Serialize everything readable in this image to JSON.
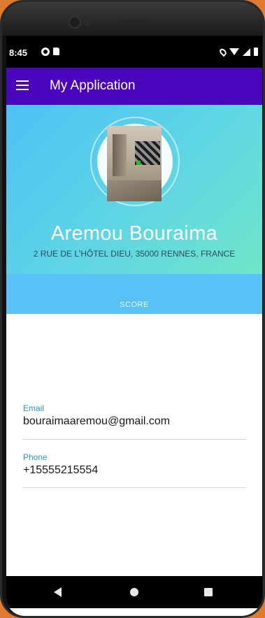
{
  "status_bar": {
    "time": "8:45",
    "left_icons": [
      "google-icon",
      "sd-card-icon"
    ],
    "right_icons": [
      "location-icon",
      "wifi-icon",
      "signal-icon",
      "battery-icon"
    ]
  },
  "app_bar": {
    "title": "My Application",
    "menu_icon": "menu-icon",
    "color": "#4a05bd"
  },
  "profile": {
    "name": "Aremou Bouraima",
    "address": "2 RUE DE L'HÔTEL DIEU, 35000 RENNES, FRANCE",
    "avatar_icon": "avatar-photo"
  },
  "score": {
    "label": "SCORE"
  },
  "fields": {
    "email": {
      "label": "Email",
      "value": "bouraimaaremou@gmail.com"
    },
    "phone": {
      "label": "Phone",
      "value": "+15555215554"
    }
  },
  "nav_bar": {
    "buttons": [
      "back-icon",
      "home-icon",
      "recents-icon"
    ]
  },
  "colors": {
    "header_gradient_start": "#4fc0f5",
    "header_gradient_end": "#6ee6c8",
    "score_bar": "#58c2f7",
    "field_label": "#2a98c9"
  }
}
